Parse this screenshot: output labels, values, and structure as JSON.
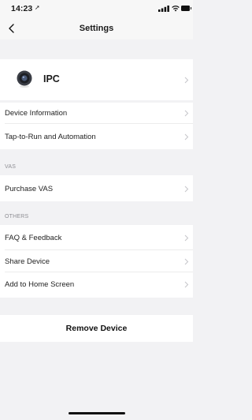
{
  "status_bar": {
    "time": "14:23",
    "location_glyph": "➚"
  },
  "nav": {
    "title": "Settings"
  },
  "device": {
    "name": "IPC"
  },
  "menu": {
    "device_information": "Device Information",
    "tap_to_run": "Tap-to-Run and Automation",
    "vas_header": "VAS",
    "purchase_vas": "Purchase VAS",
    "others_header": "OTHERS",
    "faq_feedback": "FAQ & Feedback",
    "share_device": "Share Device",
    "add_home_screen": "Add to Home Screen"
  },
  "actions": {
    "remove_device": "Remove Device"
  },
  "colors": {
    "background": "#f2f2f4",
    "row": "#ffffff",
    "section_text": "#8e8e93",
    "chevron": "#c7c7cc"
  }
}
